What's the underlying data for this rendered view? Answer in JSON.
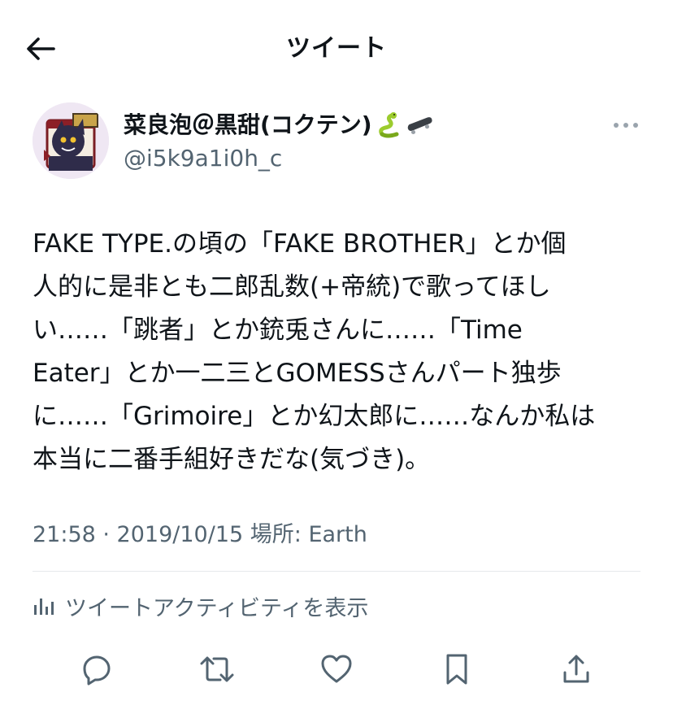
{
  "header": {
    "title": "ツイート",
    "back_icon": "arrow-left-icon"
  },
  "tweet": {
    "author": {
      "display_name": "菜良泡＠黒甜(コクテン)",
      "emojis": [
        "snake-emoji",
        "skateboard-emoji"
      ],
      "handle": "@i5k9a1i0h_c"
    },
    "text": "FAKE TYPE.の頃の「FAKE BROTHER」とか個\n人的に是非とも二郎乱数(+帝統)で歌ってほし\nい……「跳者」とか銃兎さんに……「Time\nEater」とか一二三とGOMESSさんパート独歩\nに……「Grimoire」とか幻太郎に……なんか私は\n本当に二番手組好きだな(気づき)。",
    "meta": "21:58 · 2019/10/15 場所: Earth",
    "activity_label": "ツイートアクティビティを表示"
  },
  "actions": [
    {
      "name": "reply",
      "icon": "reply-icon"
    },
    {
      "name": "retweet",
      "icon": "retweet-icon"
    },
    {
      "name": "like",
      "icon": "heart-icon"
    },
    {
      "name": "bookmark",
      "icon": "bookmark-icon"
    },
    {
      "name": "share",
      "icon": "share-icon"
    }
  ],
  "colors": {
    "text": "#0f1419",
    "secondary": "#536471",
    "divider": "#e6e9ec",
    "snake": "#9ccc2e",
    "skateboard": "#3a3f45"
  }
}
